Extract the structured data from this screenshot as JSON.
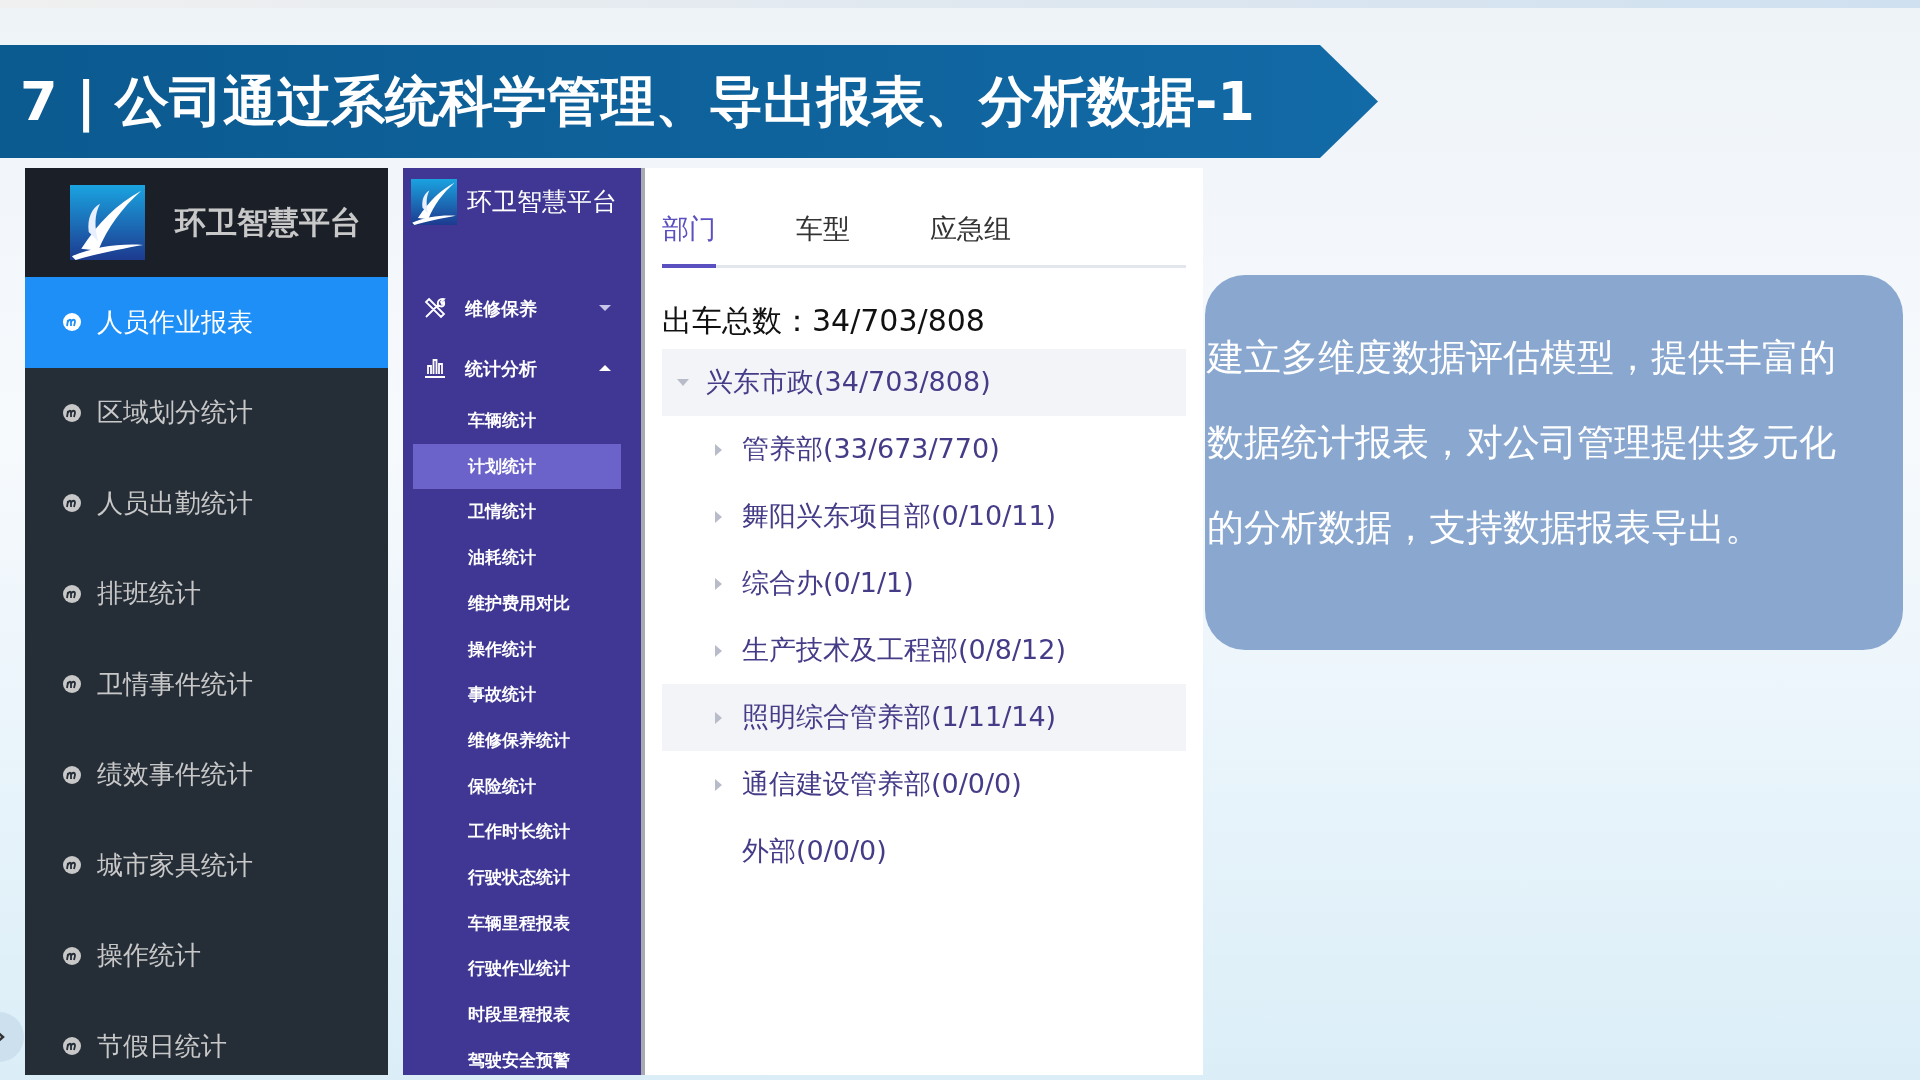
{
  "slide_title": "7 | 公司通过系统科学管理、导出报表、分析数据-1",
  "sidebar": {
    "logo_text": "环卫智慧平台",
    "items": [
      {
        "label": "人员作业报表",
        "selected": true
      },
      {
        "label": "区域划分统计",
        "selected": false
      },
      {
        "label": "人员出勤统计",
        "selected": false
      },
      {
        "label": "排班统计",
        "selected": false
      },
      {
        "label": "卫情事件统计",
        "selected": false
      },
      {
        "label": "绩效事件统计",
        "selected": false
      },
      {
        "label": "城市家具统计",
        "selected": false
      },
      {
        "label": "操作统计",
        "selected": false
      },
      {
        "label": "节假日统计",
        "selected": false
      }
    ]
  },
  "menu": {
    "logo_text": "环卫智慧平台",
    "groups": [
      {
        "label": "维修保养",
        "expanded": false
      },
      {
        "label": "统计分析",
        "expanded": true,
        "children": [
          {
            "label": "车辆统计",
            "selected": false
          },
          {
            "label": "计划统计",
            "selected": true
          },
          {
            "label": "卫情统计",
            "selected": false
          },
          {
            "label": "油耗统计",
            "selected": false
          },
          {
            "label": "维护费用对比",
            "selected": false
          },
          {
            "label": "操作统计",
            "selected": false
          },
          {
            "label": "事故统计",
            "selected": false
          },
          {
            "label": "维修保养统计",
            "selected": false
          },
          {
            "label": "保险统计",
            "selected": false
          },
          {
            "label": "工作时长统计",
            "selected": false
          },
          {
            "label": "行驶状态统计",
            "selected": false
          },
          {
            "label": "车辆里程报表",
            "selected": false
          },
          {
            "label": "行驶作业统计",
            "selected": false
          },
          {
            "label": "时段里程报表",
            "selected": false
          },
          {
            "label": "驾驶安全预警",
            "selected": false
          }
        ]
      }
    ]
  },
  "tabs": [
    {
      "label": "部门",
      "selected": true
    },
    {
      "label": "车型",
      "selected": false
    },
    {
      "label": "应急组",
      "selected": false
    }
  ],
  "summary": "出车总数：34/703/808",
  "tree": [
    {
      "label": "兴东市政(34/703/808)",
      "expandable": true,
      "expanded": true,
      "highlighted": true,
      "children": [
        {
          "label": "管养部(33/673/770)",
          "expandable": true,
          "expanded": false,
          "highlighted": false
        },
        {
          "label": "舞阳兴东项目部(0/10/11)",
          "expandable": true,
          "expanded": false,
          "highlighted": false
        },
        {
          "label": "综合办(0/1/1)",
          "expandable": true,
          "expanded": false,
          "highlighted": false
        },
        {
          "label": "生产技术及工程部(0/8/12)",
          "expandable": true,
          "expanded": false,
          "highlighted": false
        },
        {
          "label": "照明综合管养部(1/11/14)",
          "expandable": true,
          "expanded": false,
          "highlighted": true
        },
        {
          "label": "通信建设管养部(0/0/0)",
          "expandable": true,
          "expanded": false,
          "highlighted": false
        },
        {
          "label": "外部(0/0/0)",
          "expandable": false,
          "expanded": false,
          "highlighted": false
        }
      ]
    }
  ],
  "callout": "建立多维度数据评估模型，提供丰富的数据统计报表，对公司管理提供多元化的分析数据，支持数据报表导出。"
}
